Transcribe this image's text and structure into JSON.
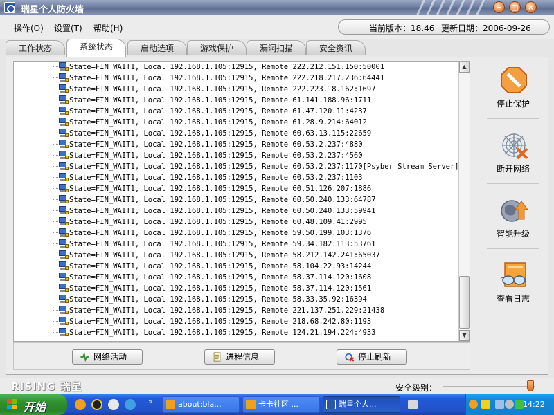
{
  "window": {
    "title": "瑞星个人防火墙",
    "min": "−",
    "max": "□",
    "close": "×"
  },
  "menu": {
    "items": [
      "操作(O)",
      "设置(T)",
      "帮助(H)"
    ]
  },
  "version": {
    "current": "当前版本：18.46",
    "updated": "更新日期：2006-09-26"
  },
  "tabs": [
    "工作状态",
    "系统状态",
    "启动选项",
    "游戏保护",
    "漏洞扫描",
    "安全资讯"
  ],
  "connections": [
    "State=FIN_WAIT1, Local 192.168.1.105:12915, Remote 222.212.151.150:50001",
    "State=FIN_WAIT1, Local 192.168.1.105:12915, Remote 222.218.217.236:64441",
    "State=FIN_WAIT1, Local 192.168.1.105:12915, Remote 222.223.18.162:1697",
    "State=FIN_WAIT1, Local 192.168.1.105:12915, Remote 61.141.188.96:1711",
    "State=FIN_WAIT1, Local 192.168.1.105:12915, Remote 61.47.120.11:4237",
    "State=FIN_WAIT1, Local 192.168.1.105:12915, Remote 61.28.9.214:64012",
    "State=FIN_WAIT1, Local 192.168.1.105:12915, Remote 60.63.13.115:22659",
    "State=FIN_WAIT1, Local 192.168.1.105:12915, Remote 60.53.2.237:4880",
    "State=FIN_WAIT1, Local 192.168.1.105:12915, Remote 60.53.2.237:4560",
    "State=FIN_WAIT1, Local 192.168.1.105:12915, Remote 60.53.2.237:1170[Psyber Stream Server]",
    "State=FIN_WAIT1, Local 192.168.1.105:12915, Remote 60.53.2.237:1103",
    "State=FIN_WAIT1, Local 192.168.1.105:12915, Remote 60.51.126.207:1886",
    "State=FIN_WAIT1, Local 192.168.1.105:12915, Remote 60.50.240.133:64787",
    "State=FIN_WAIT1, Local 192.168.1.105:12915, Remote 60.50.240.133:59941",
    "State=FIN_WAIT1, Local 192.168.1.105:12915, Remote 60.48.109.41:2995",
    "State=FIN_WAIT1, Local 192.168.1.105:12915, Remote 59.50.199.103:1376",
    "State=FIN_WAIT1, Local 192.168.1.105:12915, Remote 59.34.182.113:53761",
    "State=FIN_WAIT1, Local 192.168.1.105:12915, Remote 58.212.142.241:65037",
    "State=FIN_WAIT1, Local 192.168.1.105:12915, Remote 58.104.22.93:14244",
    "State=FIN_WAIT1, Local 192.168.1.105:12915, Remote 58.37.114.120:1608",
    "State=FIN_WAIT1, Local 192.168.1.105:12915, Remote 58.37.114.120:1561",
    "State=FIN_WAIT1, Local 192.168.1.105:12915, Remote 58.33.35.92:16394",
    "State=FIN_WAIT1, Local 192.168.1.105:12915, Remote 221.137.251.229:21438",
    "State=FIN_WAIT1, Local 192.168.1.105:12915, Remote 218.68.242.80:1193",
    "State=FIN_WAIT1, Local 192.168.1.105:12915, Remote 124.21.194.224:4933"
  ],
  "buttons": {
    "network": "网络活动",
    "process": "进程信息",
    "refresh": "停止刷新"
  },
  "side": {
    "stop": "停止保护",
    "disconnect": "断开网络",
    "upgrade": "智能升级",
    "log": "查看日志"
  },
  "footer": {
    "logo": "RISING 瑞星",
    "level_label": "安全级别：",
    "level_fraction": 1.0
  },
  "taskbar": {
    "start": "开始",
    "tasks": [
      "about:bla...",
      "卡卡社区 ...",
      "瑞星个人..."
    ],
    "clock": "14:22"
  },
  "colors": {
    "accent": "#e06a1e",
    "titlebar": "#6f7fa3",
    "taskbar": "#2459d8",
    "start": "#2f8f2f"
  }
}
